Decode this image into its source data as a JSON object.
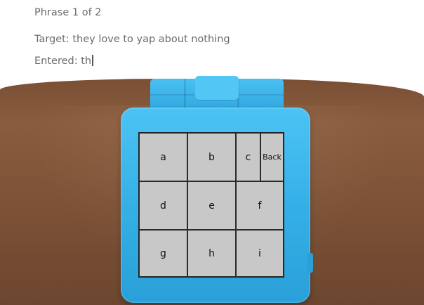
{
  "header": {
    "phrase_counter": "Phrase 1 of 2",
    "target": "Target: they love to yap about nothing",
    "entered": "Entered: th"
  },
  "keyboard": {
    "keys": [
      {
        "label": "a"
      },
      {
        "label": "b"
      },
      {
        "label": "c"
      },
      {
        "label": "Back"
      },
      {
        "label": "d"
      },
      {
        "label": "e"
      },
      {
        "label": "f"
      },
      {
        "label": "g"
      },
      {
        "label": "h"
      },
      {
        "label": "i"
      }
    ]
  },
  "colors": {
    "watch": "#3bb3e9",
    "key_bg": "#c8c8c8",
    "text": "#6b6b6b"
  }
}
